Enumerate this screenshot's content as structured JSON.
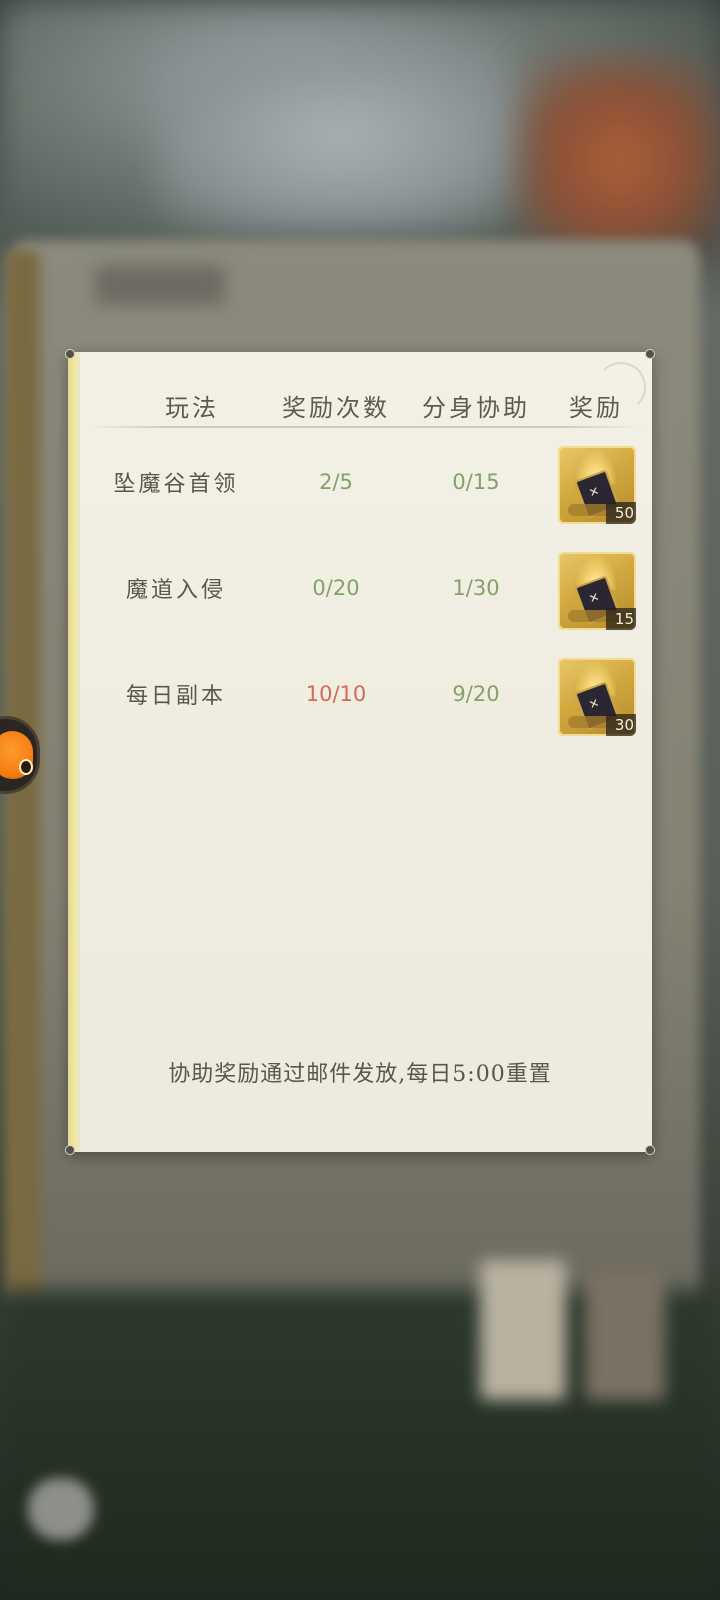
{
  "table": {
    "headers": {
      "play": "玩法",
      "count": "奖励次数",
      "assist": "分身协助",
      "reward": "奖励"
    },
    "rows": [
      {
        "name": "坠魔谷首领",
        "count": "2/5",
        "count_status": "normal",
        "assist": "0/15",
        "reward_qty": "50",
        "reward_icon": "golden-tome-icon"
      },
      {
        "name": "魔道入侵",
        "count": "0/20",
        "count_status": "normal",
        "assist": "1/30",
        "reward_qty": "15",
        "reward_icon": "golden-tome-icon"
      },
      {
        "name": "每日副本",
        "count": "10/10",
        "count_status": "maxed",
        "assist": "9/20",
        "reward_qty": "30",
        "reward_icon": "golden-tome-icon"
      }
    ]
  },
  "footer": {
    "note": "协助奖励通过邮件发放,每日5:00重置"
  },
  "colors": {
    "value_normal": "#86a06a",
    "value_maxed": "#d26a5c",
    "panel_background": "#f0ede1"
  }
}
